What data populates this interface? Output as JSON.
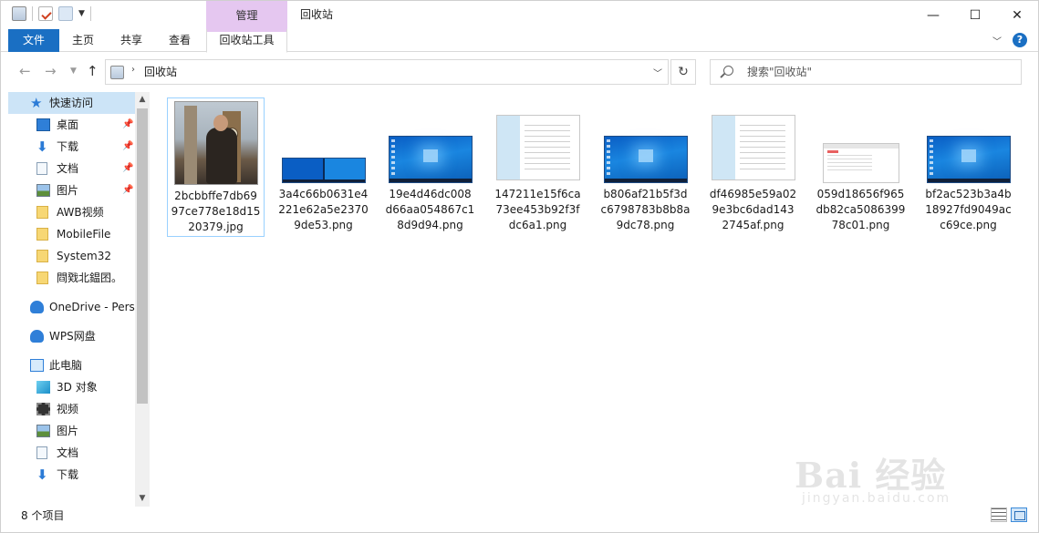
{
  "window": {
    "title": "回收站",
    "context_tab_header": "管理",
    "buttons": {
      "minimize": "—",
      "maximize": "☐",
      "close": "✕"
    }
  },
  "ribbon": {
    "tabs": [
      {
        "label": "文件"
      },
      {
        "label": "主页"
      },
      {
        "label": "共享"
      },
      {
        "label": "查看"
      },
      {
        "label": "回收站工具"
      }
    ],
    "accent": "#1a6fc3",
    "context_color": "#e5c7f0"
  },
  "nav": {
    "address": "回收站",
    "search_placeholder": "搜索\"回收站\""
  },
  "sidebar": {
    "items": [
      {
        "label": "快速访问",
        "icon": "star-icon"
      },
      {
        "label": "桌面",
        "icon": "desktop-icon",
        "pinned": true
      },
      {
        "label": "下载",
        "icon": "download-icon",
        "pinned": true
      },
      {
        "label": "文档",
        "icon": "document-icon",
        "pinned": true
      },
      {
        "label": "图片",
        "icon": "picture-icon",
        "pinned": true
      },
      {
        "label": "AWB视频",
        "icon": "folder-icon"
      },
      {
        "label": "MobileFile",
        "icon": "folder-icon"
      },
      {
        "label": "System32",
        "icon": "folder-icon"
      },
      {
        "label": "閰戣北鎾囨。",
        "icon": "folder-icon"
      },
      {
        "label": "OneDrive - Personal",
        "icon": "onedrive-cloud-icon"
      },
      {
        "label": "WPS网盘",
        "icon": "wps-cloud-icon"
      },
      {
        "label": "此电脑",
        "icon": "computer-icon"
      },
      {
        "label": "3D 对象",
        "icon": "cube-icon"
      },
      {
        "label": "视频",
        "icon": "video-icon"
      },
      {
        "label": "图片",
        "icon": "picture-icon"
      },
      {
        "label": "文档",
        "icon": "document-icon"
      },
      {
        "label": "下载",
        "icon": "download-icon"
      }
    ]
  },
  "files": [
    {
      "name": "2bcbbffe7db6997ce778e18d1520379.jpg",
      "lines": [
        "2bcbbffe7db69",
        "97ce778e18d15",
        "20379.jpg"
      ],
      "thumb": "photo"
    },
    {
      "name": "3a4c66b0631e4221e62a5e23709de53.png",
      "lines": [
        "3a4c66b0631e4",
        "221e62a5e2370",
        "9de53.png"
      ],
      "thumb": "wide-desktop"
    },
    {
      "name": "19e4d46dc008d66aa054867c18d9d94.png",
      "lines": [
        "19e4d46dc008",
        "d66aa054867c1",
        "8d9d94.png"
      ],
      "thumb": "desktop"
    },
    {
      "name": "147211e15f6ca73ee453b92f3fdc6a1.png",
      "lines": [
        "147211e15f6ca",
        "73ee453b92f3f",
        "dc6a1.png"
      ],
      "thumb": "settings-doc"
    },
    {
      "name": "b806af21b5f3dc6798783b8b8a9dc78.png",
      "lines": [
        "b806af21b5f3d",
        "c6798783b8b8a",
        "9dc78.png"
      ],
      "thumb": "desktop"
    },
    {
      "name": "df46985e59a029e3bc6dad1432745af.png",
      "lines": [
        "df46985e59a02",
        "9e3bc6dad143",
        "2745af.png"
      ],
      "thumb": "settings-doc"
    },
    {
      "name": "059d18656f965db82ca508639978c01.png",
      "lines": [
        "059d18656f965",
        "db82ca5086399",
        "78c01.png"
      ],
      "thumb": "mini-window"
    },
    {
      "name": "bf2ac523b3a4b18927fd9049acc69ce.png",
      "lines": [
        "bf2ac523b3a4b",
        "18927fd9049ac",
        "c69ce.png"
      ],
      "thumb": "desktop"
    }
  ],
  "status": {
    "count_text": "8 个项目"
  },
  "watermark": {
    "main": "Bai 经验",
    "sub": "jingyan.baidu.com"
  }
}
